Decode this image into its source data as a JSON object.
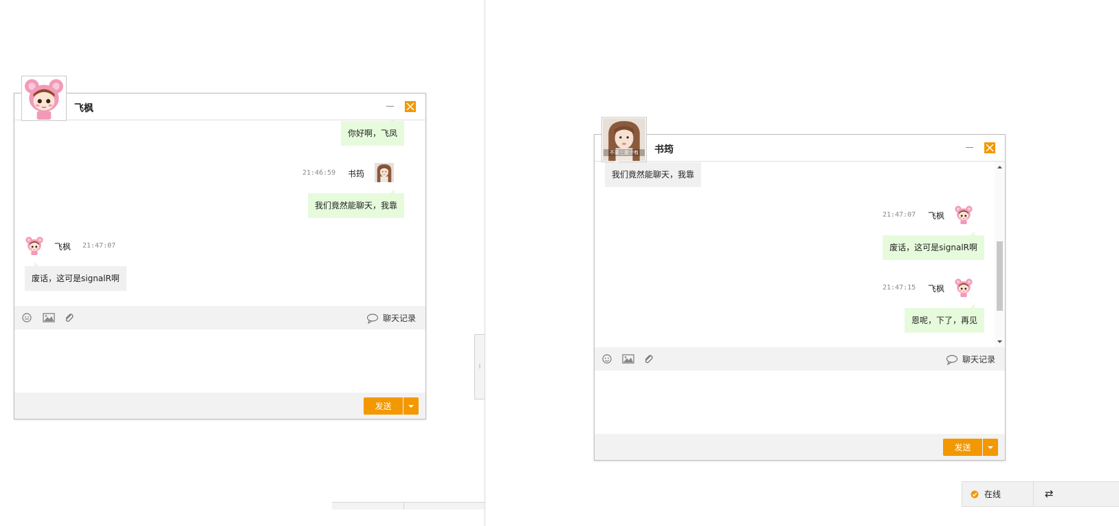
{
  "left_window": {
    "contact_name": "飞枫",
    "messages": [
      {
        "text": "你好啊，飞凤"
      },
      {
        "time": "21:46:59",
        "name": "书筠",
        "text": "我们竟然能聊天，我靠"
      },
      {
        "time": "21:47:07",
        "name": "飞枫",
        "text": "废话，这可是signalR啊"
      }
    ],
    "history_label": "聊天记录",
    "send_label": "发送"
  },
  "right_window": {
    "contact_name": "书筠",
    "avatar_caption": "不要三提少有",
    "messages": [
      {
        "text": "我们竟然能聊天，我靠"
      },
      {
        "time": "21:47:07",
        "name": "飞枫",
        "text": "废话，这可是signalR啊"
      },
      {
        "time": "21:47:15",
        "name": "飞枫",
        "text": "恩呢，下了，再见"
      }
    ],
    "history_label": "聊天记录",
    "send_label": "发送"
  },
  "status_bar": {
    "online_label": "在线",
    "switch_icon": "⇄"
  },
  "colors": {
    "accent": "#f39800",
    "bubble_self": "#e6fbdc",
    "bubble_other": "#f0f0f0",
    "toolbar_bg": "#f2f2f2"
  }
}
